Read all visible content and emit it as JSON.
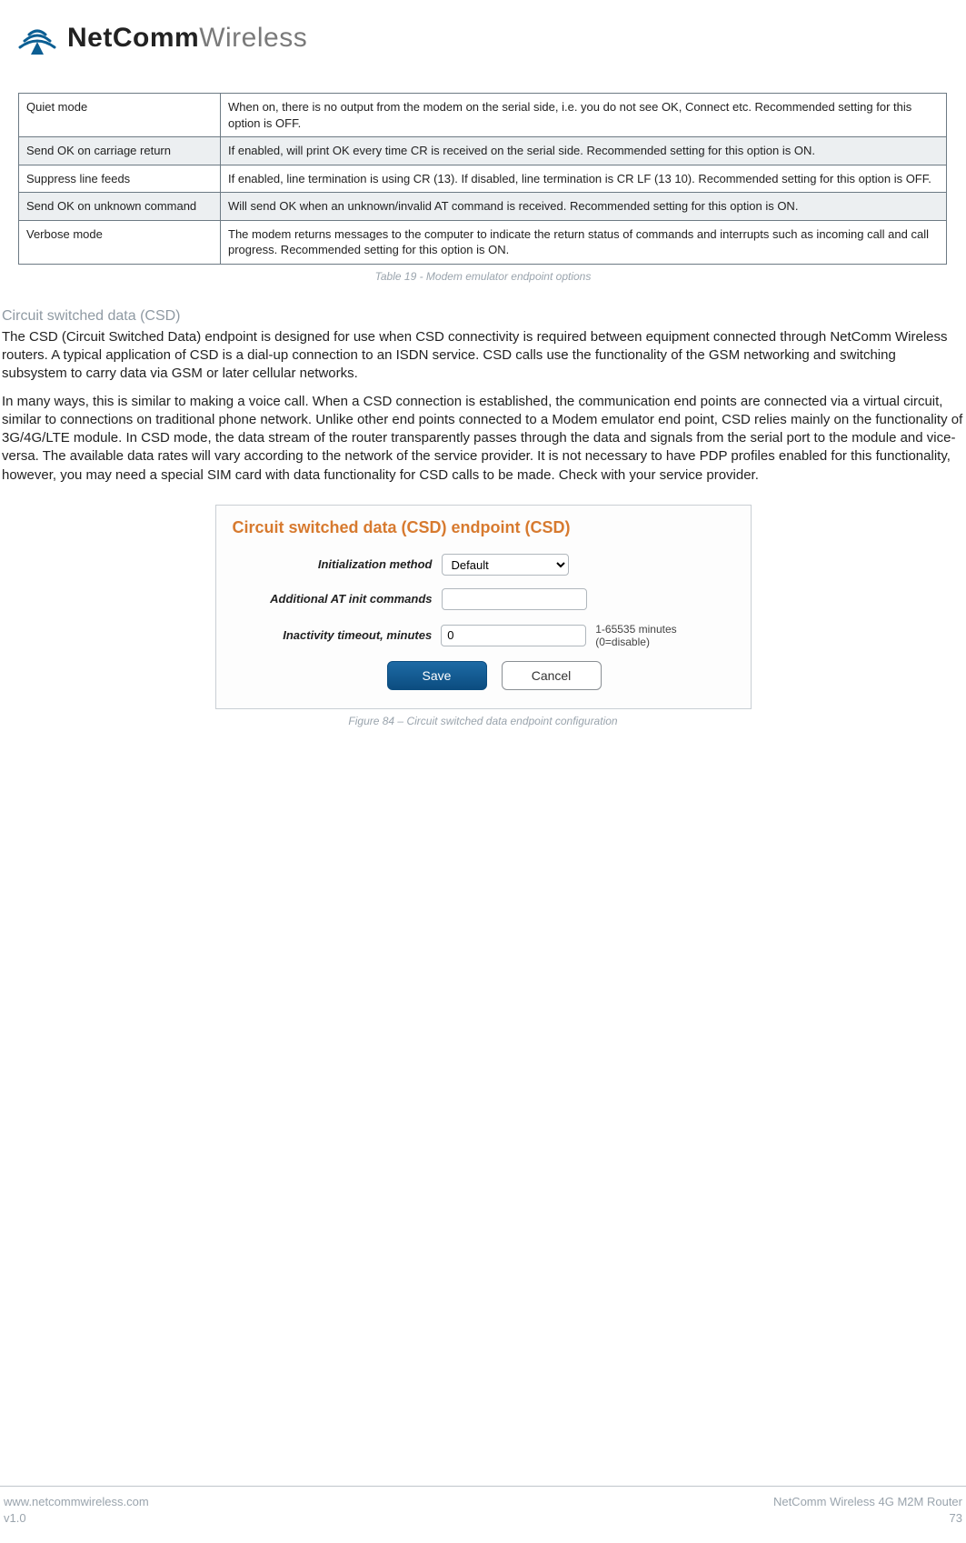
{
  "header": {
    "brand_bold": "NetComm",
    "brand_light": "Wireless"
  },
  "options_table": {
    "rows": [
      {
        "label": "Quiet mode",
        "desc": "When on, there is no output from the modem on the serial side, i.e. you do not see OK, Connect etc. Recommended setting for this option is OFF."
      },
      {
        "label": "Send OK on carriage return",
        "desc": "If enabled, will print OK every time CR is received on the serial side. Recommended setting for this option is ON."
      },
      {
        "label": "Suppress line feeds",
        "desc": "If enabled, line termination is using CR (13). If disabled, line termination is CR LF (13 10). Recommended setting for this option is OFF."
      },
      {
        "label": "Send OK on unknown command",
        "desc": "Will send OK when an unknown/invalid AT command is received. Recommended setting for this option is ON."
      },
      {
        "label": "Verbose mode",
        "desc": "The modem returns messages to the computer to indicate the return status of commands and interrupts such as incoming call and call progress. Recommended setting for this option is ON."
      }
    ],
    "caption": "Table 19 - Modem emulator endpoint options"
  },
  "section": {
    "heading": "Circuit switched data (CSD)",
    "p1": "The CSD (Circuit Switched Data) endpoint is designed for use when CSD connectivity is required between equipment connected through NetComm Wireless routers. A typical application of CSD is a dial-up connection to an ISDN service. CSD calls use the functionality of the GSM networking and switching subsystem to carry data via GSM or later cellular networks.",
    "p2": "In many ways, this is similar to making a voice call. When a CSD connection is established, the communication end points are connected via a virtual circuit, similar to connections on traditional phone network. Unlike other end points connected to a Modem emulator end point, CSD relies mainly on the functionality of 3G/4G/LTE module. In CSD mode, the data stream of the router transparently passes through the data and signals from the serial port to the module and vice-versa. The available data rates will vary according to the network of the service provider. It is not necessary to have PDP profiles enabled for this functionality, however, you may need a special SIM card with data functionality for CSD calls to be made. Check with your service provider."
  },
  "figure": {
    "title": "Circuit switched data (CSD) endpoint (CSD)",
    "init_label": "Initialization method",
    "init_value": "Default",
    "at_label": "Additional AT init commands",
    "at_value": "",
    "timeout_label": "Inactivity timeout, minutes",
    "timeout_value": "0",
    "timeout_hint": "1-65535 minutes (0=disable)",
    "save": "Save",
    "cancel": "Cancel",
    "caption": "Figure 84 – Circuit switched data endpoint configuration"
  },
  "footer": {
    "url": "www.netcommwireless.com",
    "ver": "v1.0",
    "prod": "NetComm Wireless 4G M2M Router",
    "page": "73"
  }
}
